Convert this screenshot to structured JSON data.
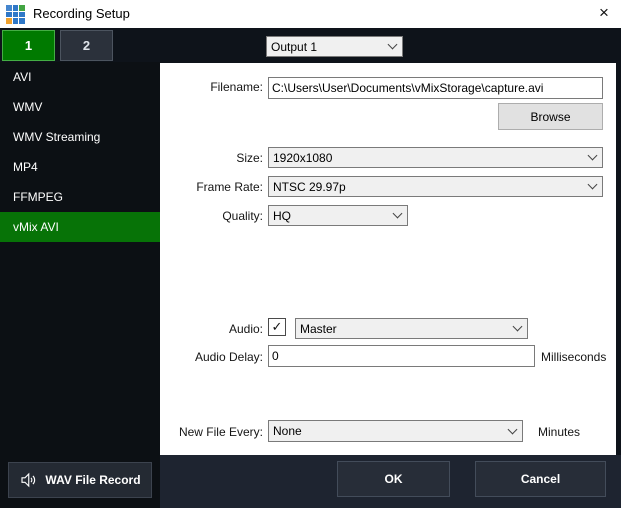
{
  "window": {
    "title": "Recording Setup",
    "close_glyph": "×"
  },
  "tabs": [
    {
      "label": "1",
      "active": true
    },
    {
      "label": "2",
      "active": false
    }
  ],
  "output_select": {
    "value": "Output 1"
  },
  "sidebar": {
    "items": [
      {
        "label": "AVI",
        "selected": false
      },
      {
        "label": "WMV",
        "selected": false
      },
      {
        "label": "WMV Streaming",
        "selected": false
      },
      {
        "label": "MP4",
        "selected": false
      },
      {
        "label": "FFMPEG",
        "selected": false
      },
      {
        "label": "vMix AVI",
        "selected": true
      }
    ],
    "wav_button_label": "WAV File Record"
  },
  "form": {
    "filename": {
      "label": "Filename:",
      "value": "C:\\Users\\User\\Documents\\vMixStorage\\capture.avi"
    },
    "browse_label": "Browse",
    "size": {
      "label": "Size:",
      "value": "1920x1080"
    },
    "frame_rate": {
      "label": "Frame Rate:",
      "value": "NTSC 29.97p"
    },
    "quality": {
      "label": "Quality:",
      "value": "HQ"
    },
    "audio": {
      "label": "Audio:",
      "checked": true,
      "check_glyph": "✓",
      "value": "Master"
    },
    "audio_delay": {
      "label": "Audio Delay:",
      "value": "0",
      "unit": "Milliseconds"
    },
    "new_file_every": {
      "label": "New File Every:",
      "value": "None",
      "unit": "Minutes"
    }
  },
  "footer": {
    "ok_label": "OK",
    "cancel_label": "Cancel"
  },
  "colors": {
    "accent_green": "#077307",
    "tab_active_fill": "#007a00",
    "tab_active_border": "#44ad44",
    "panel_bg": "#ffffff",
    "dark_bg": "#0e131a",
    "footer_bg": "#1e2430"
  }
}
